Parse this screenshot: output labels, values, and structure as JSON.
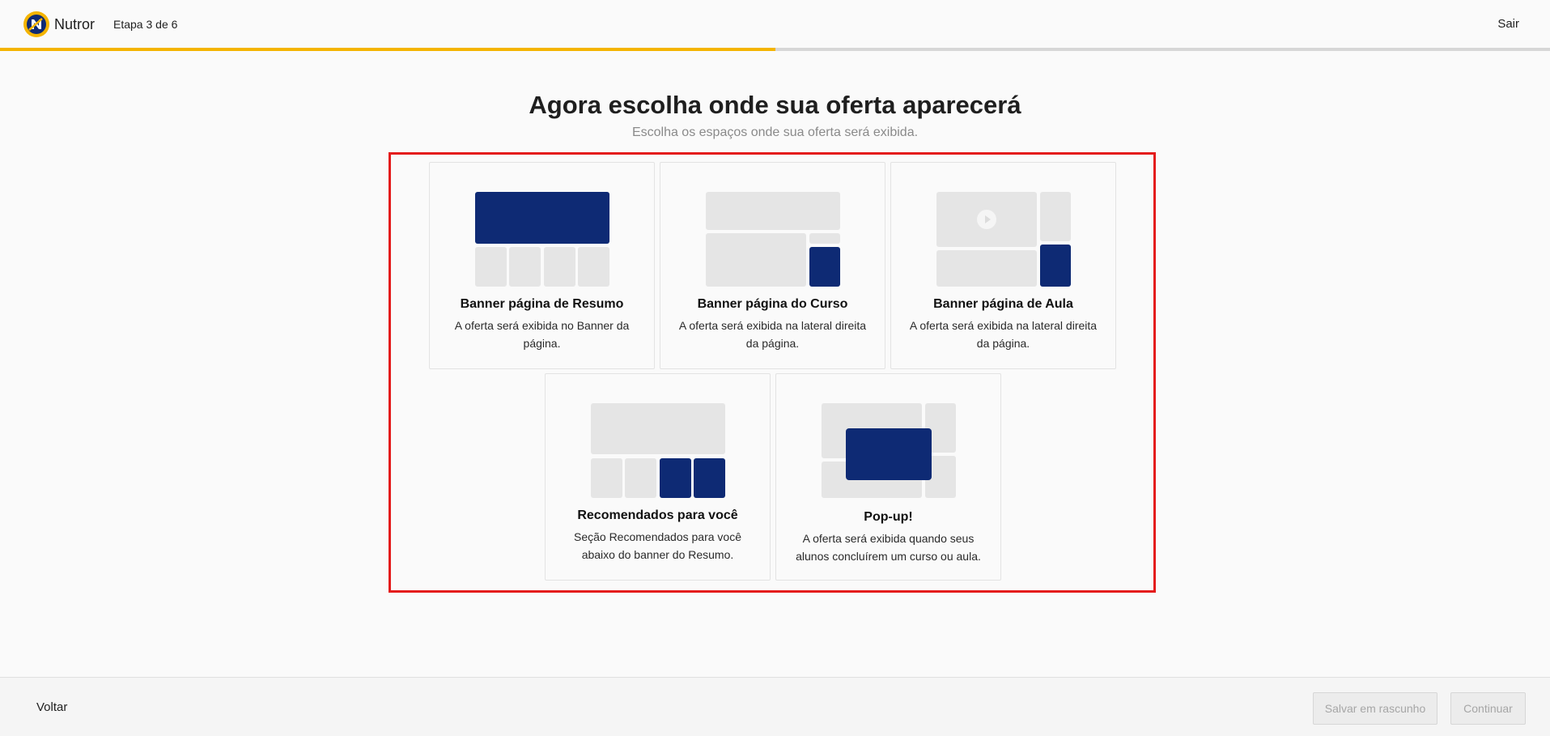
{
  "header": {
    "brand": "Nutror",
    "step": "Etapa 3 de 6",
    "exit_label": "Sair",
    "progress_fraction": 0.5,
    "accent_color": "#f4b400"
  },
  "main": {
    "title": "Agora escolha onde sua oferta aparecerá",
    "subtitle": "Escolha os espaços onde sua oferta será exibida.",
    "cards": [
      {
        "title": "Banner página de Resumo",
        "description": "A oferta será exibida no Banner da página."
      },
      {
        "title": "Banner página do Curso",
        "description": "A oferta será exibida na lateral direita da página."
      },
      {
        "title": "Banner página de Aula",
        "description": "A oferta será exibida na lateral direita da página."
      },
      {
        "title": "Recomendados para você",
        "description": "Seção Recomendados para você abaixo do banner do Resumo."
      },
      {
        "title": "Pop-up!",
        "description": "A oferta será exibida quando seus alunos concluírem um curso ou aula."
      }
    ],
    "highlight_color": "#e41b1b",
    "placeholder_color": "#0e2a74"
  },
  "footer": {
    "back_label": "Voltar",
    "draft_label": "Salvar em rascunho",
    "continue_label": "Continuar"
  }
}
